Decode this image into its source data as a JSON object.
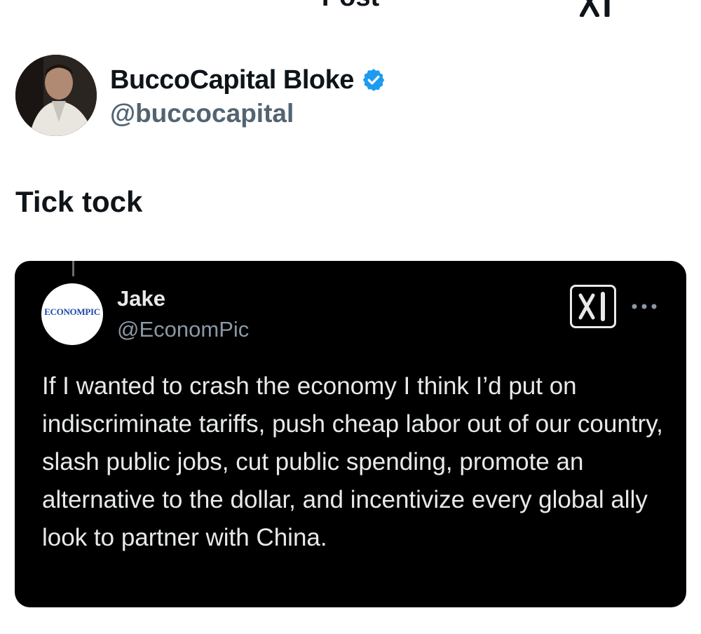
{
  "header": {
    "title": "Post",
    "back_icon": "arrow-left-icon",
    "grok_icon": "grok-icon",
    "more_icon": "more-horizontal-icon"
  },
  "author": {
    "name": "BuccoCapital Bloke",
    "handle": "@buccocapital",
    "verified": true
  },
  "post": {
    "text": "Tick tock"
  },
  "quoted_screenshot": {
    "avatar_text": "ECONOMPIC",
    "name": "Jake",
    "handle": "@EconomPic",
    "text": "If I wanted to crash the economy I think I’d put on indiscriminate tariffs, push cheap labor out of our country, slash public jobs, cut public spending, promote an alternative to the dollar, and incentivize every global ally look to partner with China."
  },
  "colors": {
    "text_primary": "#0f1419",
    "text_secondary": "#536471",
    "verified_blue": "#1d9bf0",
    "embed_bg": "#000000",
    "embed_text": "#e7e9ea",
    "embed_secondary": "#8b98a5"
  }
}
